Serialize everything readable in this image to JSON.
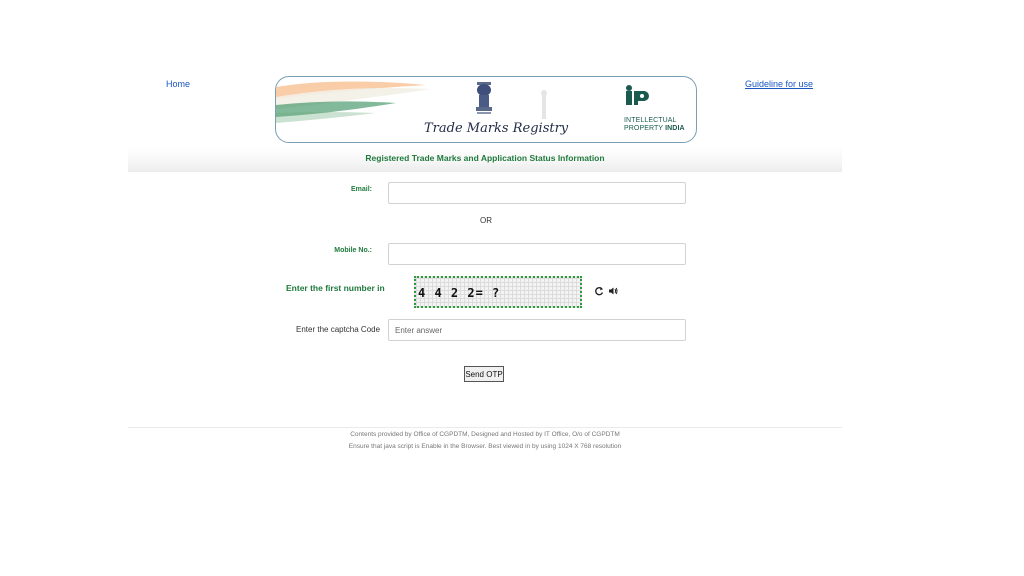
{
  "nav": {
    "home_label": "Home",
    "guideline_label": "Guideline for use"
  },
  "banner": {
    "title": "Trade Marks Registry",
    "ip_line1": "INTELLECTUAL",
    "ip_line2": "PROPERTY",
    "ip_line3": "INDIA",
    "logo_icon": "ip-india-logo-icon",
    "emblem_icon": "national-emblem-icon"
  },
  "subtitle": "Registered Trade Marks and Application Status Information",
  "form": {
    "email_label": "Email:",
    "email_value": "",
    "or_text": "OR",
    "mobile_label": "Mobile No.:",
    "mobile_value": "",
    "captcha_prompt": "Enter the first number in",
    "captcha_text": "4 4 2 2= ?",
    "captcha_code_label": "Enter the captcha Code",
    "captcha_placeholder": "Enter answer",
    "send_button": "Send OTP"
  },
  "footer": {
    "line1": "Contents provided by Office of CGPDTM, Designed and Hosted by IT Office, O/o of CGPDTM",
    "line2": "Ensure that java script is Enable in the Browser. Best viewed in by using 1024 X 768 resolution"
  },
  "colors": {
    "accent_green": "#1f7a3c",
    "link_blue": "#1a56c4",
    "captcha_border": "#2e9a3e"
  }
}
